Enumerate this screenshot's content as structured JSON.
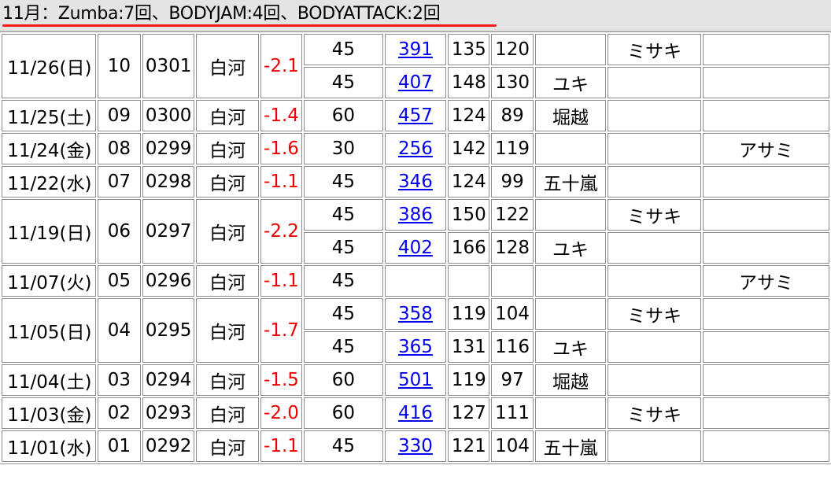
{
  "header": {
    "summary": "11月：Zumba:7回、BODYJAM:4回、BODYATTACK:2回"
  },
  "colors": {
    "negative": "#ee0000",
    "link": "#0000ee",
    "header_bg": "#e4e4e4",
    "underline": "#ff1a1a"
  },
  "records": [
    {
      "date": "11/26(日)",
      "num": "10",
      "id": "0301",
      "place": "白河",
      "weight": "-2.1",
      "sessions": [
        {
          "min": "45",
          "kcal": "391",
          "max": "135",
          "avg": "120",
          "a": "",
          "b": "ミサキ",
          "c": ""
        },
        {
          "min": "45",
          "kcal": "407",
          "max": "148",
          "avg": "130",
          "a": "ユキ",
          "b": "",
          "c": ""
        }
      ]
    },
    {
      "date": "11/25(土)",
      "num": "09",
      "id": "0300",
      "place": "白河",
      "weight": "-1.4",
      "sessions": [
        {
          "min": "60",
          "kcal": "457",
          "max": "124",
          "avg": "89",
          "a": "堀越",
          "b": "",
          "c": ""
        }
      ]
    },
    {
      "date": "11/24(金)",
      "num": "08",
      "id": "0299",
      "place": "白河",
      "weight": "-1.6",
      "sessions": [
        {
          "min": "30",
          "kcal": "256",
          "max": "142",
          "avg": "119",
          "a": "",
          "b": "",
          "c": "アサミ"
        }
      ]
    },
    {
      "date": "11/22(水)",
      "num": "07",
      "id": "0298",
      "place": "白河",
      "weight": "-1.1",
      "sessions": [
        {
          "min": "45",
          "kcal": "346",
          "max": "124",
          "avg": "99",
          "a": "五十嵐",
          "b": "",
          "c": ""
        }
      ]
    },
    {
      "date": "11/19(日)",
      "num": "06",
      "id": "0297",
      "place": "白河",
      "weight": "-2.2",
      "sessions": [
        {
          "min": "45",
          "kcal": "386",
          "max": "150",
          "avg": "122",
          "a": "",
          "b": "ミサキ",
          "c": ""
        },
        {
          "min": "45",
          "kcal": "402",
          "max": "166",
          "avg": "128",
          "a": "ユキ",
          "b": "",
          "c": ""
        }
      ]
    },
    {
      "date": "11/07(火)",
      "num": "05",
      "id": "0296",
      "place": "白河",
      "weight": "-1.1",
      "sessions": [
        {
          "min": "45",
          "kcal": "",
          "max": "",
          "avg": "",
          "a": "",
          "b": "",
          "c": "アサミ"
        }
      ]
    },
    {
      "date": "11/05(日)",
      "num": "04",
      "id": "0295",
      "place": "白河",
      "weight": "-1.7",
      "sessions": [
        {
          "min": "45",
          "kcal": "358",
          "max": "119",
          "avg": "104",
          "a": "",
          "b": "ミサキ",
          "c": ""
        },
        {
          "min": "45",
          "kcal": "365",
          "max": "131",
          "avg": "116",
          "a": "ユキ",
          "b": "",
          "c": ""
        }
      ]
    },
    {
      "date": "11/04(土)",
      "num": "03",
      "id": "0294",
      "place": "白河",
      "weight": "-1.5",
      "sessions": [
        {
          "min": "60",
          "kcal": "501",
          "max": "119",
          "avg": "97",
          "a": "堀越",
          "b": "",
          "c": ""
        }
      ]
    },
    {
      "date": "11/03(金)",
      "num": "02",
      "id": "0293",
      "place": "白河",
      "weight": "-2.0",
      "sessions": [
        {
          "min": "60",
          "kcal": "416",
          "max": "127",
          "avg": "111",
          "a": "",
          "b": "ミサキ",
          "c": ""
        }
      ]
    },
    {
      "date": "11/01(水)",
      "num": "01",
      "id": "0292",
      "place": "白河",
      "weight": "-1.1",
      "sessions": [
        {
          "min": "45",
          "kcal": "330",
          "max": "121",
          "avg": "104",
          "a": "五十嵐",
          "b": "",
          "c": ""
        }
      ]
    }
  ]
}
